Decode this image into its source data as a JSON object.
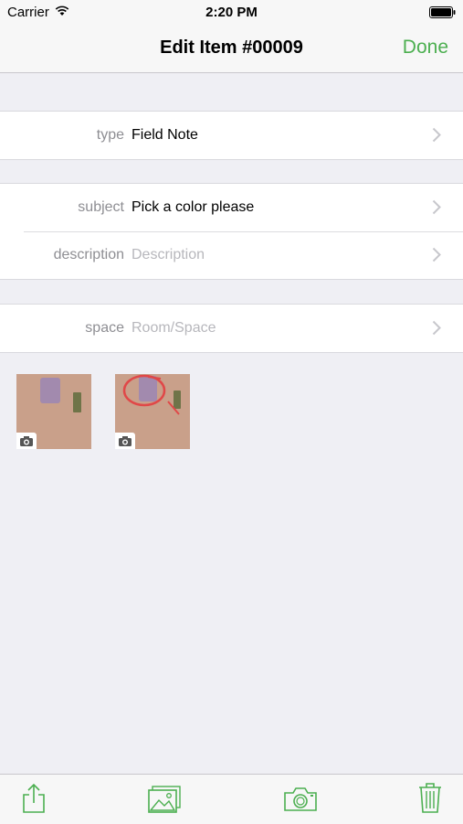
{
  "status_bar": {
    "carrier": "Carrier",
    "time": "2:20 PM"
  },
  "nav": {
    "title": "Edit Item #00009",
    "done_label": "Done"
  },
  "accent_color": "#4caf50",
  "sections": [
    {
      "rows": [
        {
          "label": "type",
          "value": "Field Note",
          "placeholder": false
        }
      ]
    },
    {
      "rows": [
        {
          "label": "subject",
          "value": "Pick a color please",
          "placeholder": false
        },
        {
          "label": "description",
          "value": "Description",
          "placeholder": true
        }
      ]
    },
    {
      "rows": [
        {
          "label": "space",
          "value": "Room/Space",
          "placeholder": true
        }
      ]
    }
  ],
  "photos": [
    {
      "name": "photo-thumbnail-1",
      "badge_icon": "camera-icon"
    },
    {
      "name": "photo-thumbnail-2",
      "badge_icon": "camera-icon"
    }
  ],
  "toolbar": {
    "items": [
      {
        "icon": "share-icon"
      },
      {
        "icon": "photo-library-icon"
      },
      {
        "icon": "camera-icon"
      },
      {
        "icon": "trash-icon"
      }
    ]
  }
}
